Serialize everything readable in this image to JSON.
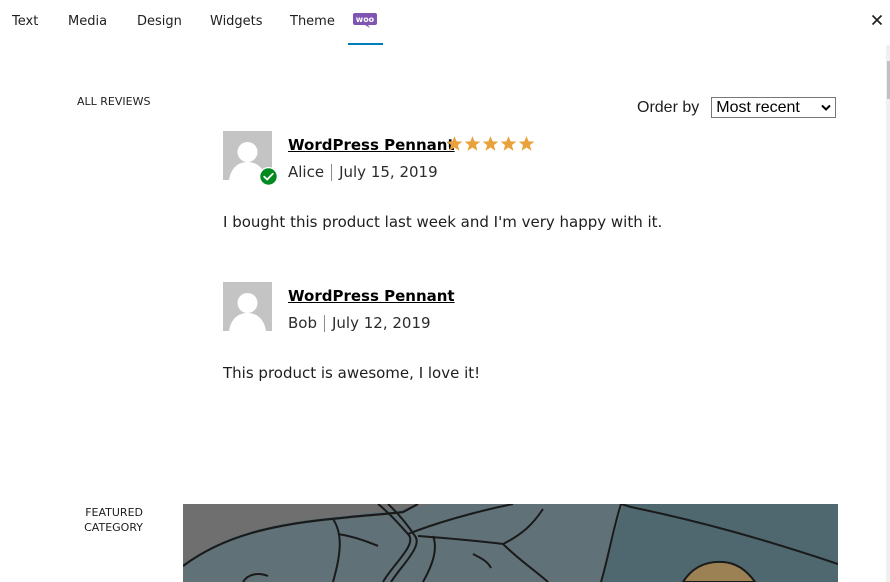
{
  "tabs": [
    {
      "label": "Text"
    },
    {
      "label": "Media"
    },
    {
      "label": "Design"
    },
    {
      "label": "Widgets"
    },
    {
      "label": "Theme"
    },
    {
      "label": "Woo",
      "icon": "woocommerce-logo-icon",
      "active": true
    }
  ],
  "close_icon": "close-icon",
  "accent_color": "#007cba",
  "woo_color": "#7f54b3",
  "star_color": "#e9a23b",
  "verified_color": "#008a20",
  "reviews_block": {
    "label": "ALL REVIEWS",
    "order_by_label": "Order by",
    "order_by_selected": "Most recent",
    "reviews": [
      {
        "product": "WordPress Pennant",
        "rating": 5,
        "rating_max": 5,
        "verified": true,
        "author": "Alice",
        "date": "July 15, 2019",
        "text": "I bought this product last week and I'm very happy with it."
      },
      {
        "product": "WordPress Pennant",
        "rating": null,
        "verified": false,
        "author": "Bob",
        "date": "July 12, 2019",
        "text": "This product is awesome, I love it!"
      }
    ]
  },
  "featured_category_block": {
    "label_line1": "FEATURED",
    "label_line2": "CATEGORY"
  }
}
